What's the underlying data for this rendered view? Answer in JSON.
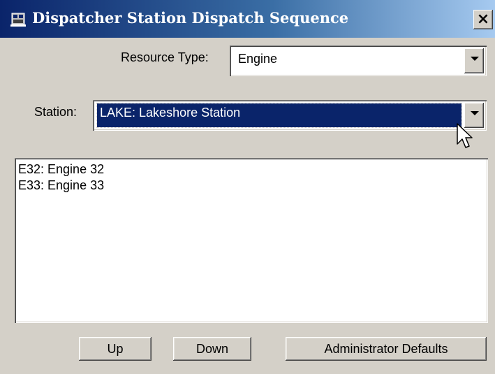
{
  "window": {
    "title": "Dispatcher Station Dispatch Sequence",
    "close_glyph": "×"
  },
  "form": {
    "resource_type_label": "Resource Type:",
    "resource_type_value": "Engine",
    "station_label": "Station:",
    "station_value": "LAKE: Lakeshore Station"
  },
  "list": {
    "items": [
      "E32: Engine 32",
      "E33: Engine 33"
    ]
  },
  "buttons": {
    "up": "Up",
    "down": "Down",
    "admin_defaults": "Administrator Defaults"
  },
  "colors": {
    "titlebar_start": "#0a246a",
    "titlebar_end": "#a6caf0",
    "selection": "#0a246a",
    "dialog_bg": "#d4d0c8"
  },
  "icons": {
    "app": "app-window-icon",
    "dropdown": "chevron-down-icon",
    "pointer": "mouse-pointer-icon"
  }
}
